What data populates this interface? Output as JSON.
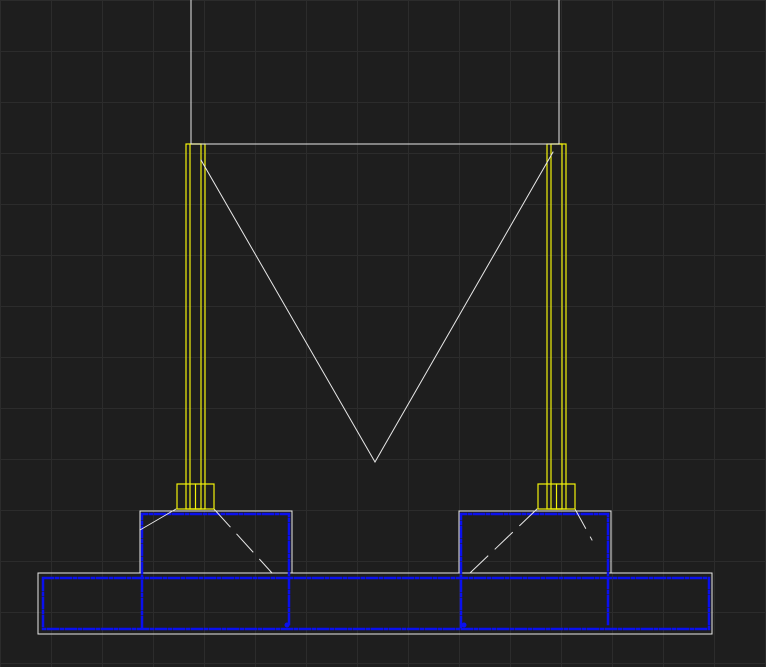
{
  "canvas": {
    "background": "#1e1e1e"
  },
  "colors": {
    "grid": "#2c2c2c",
    "line": "#e8e8e8",
    "column": "#f2f20a",
    "rebar": "#0a10ee"
  }
}
